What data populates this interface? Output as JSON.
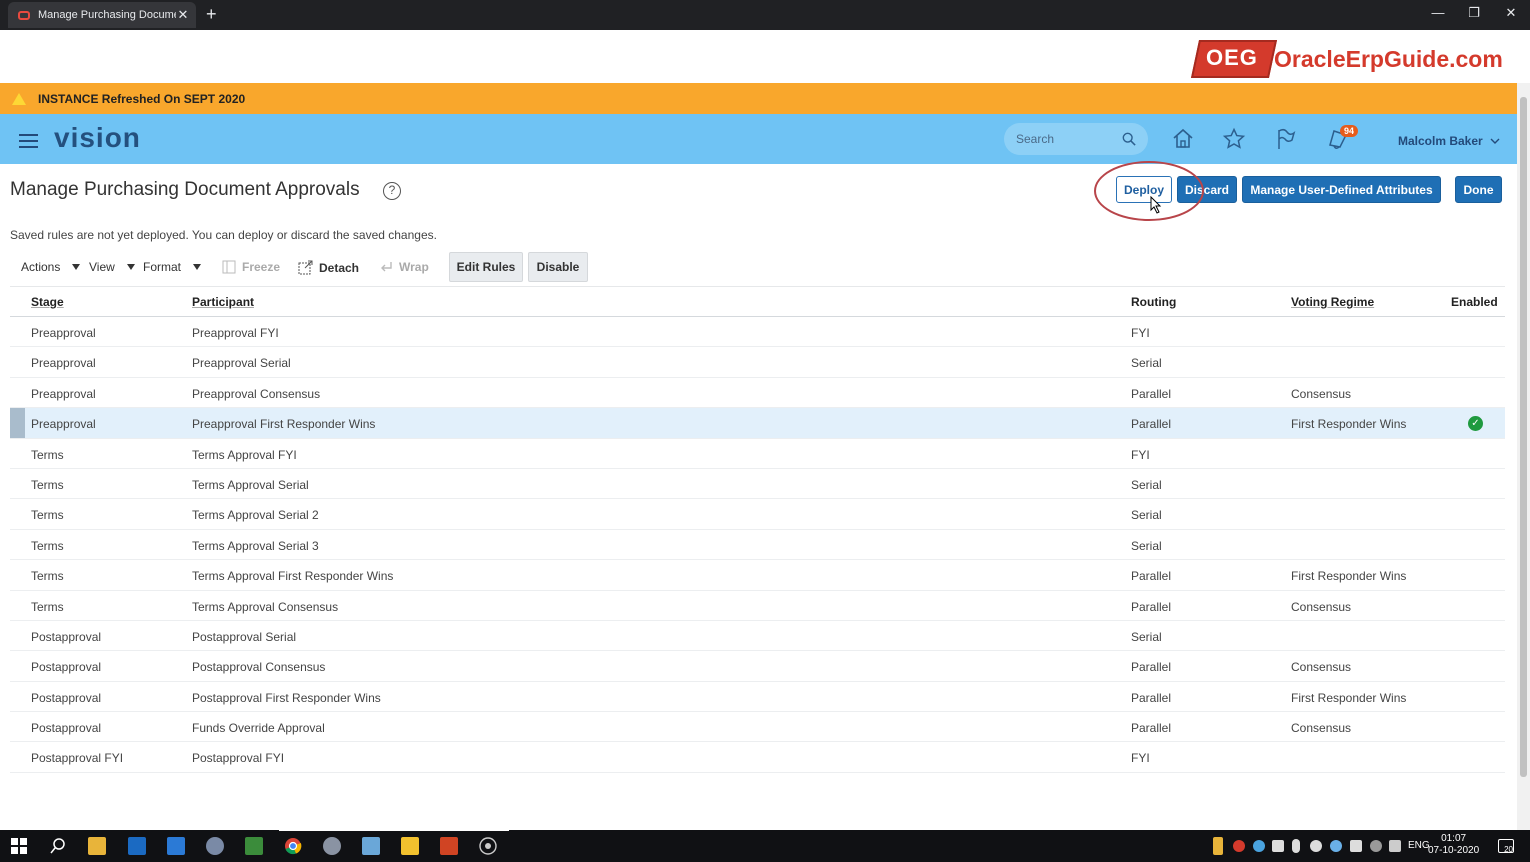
{
  "browser": {
    "tab_title": "Manage Purchasing Document A",
    "new_tab": "+",
    "tab_close": "✕",
    "minimize": "—",
    "restore": "❐",
    "close": "✕"
  },
  "brand": {
    "oeg": "OEG",
    "site": "OracleErpGuide.com"
  },
  "banner": {
    "text": "INSTANCE Refreshed On SEPT 2020",
    "color": "#f9a72c"
  },
  "header": {
    "app_name": "vision",
    "search_placeholder": "Search",
    "notifications_count": "94",
    "user_name": "Malcolm Baker",
    "accent": "#6fc3f4"
  },
  "page": {
    "title": "Manage Purchasing Document Approvals",
    "help": "?",
    "message": "Saved rules are not yet deployed. You can deploy or discard the saved changes.",
    "buttons": {
      "deploy": "Deploy",
      "discard": "Discard",
      "manage_attrs": "Manage User-Defined Attributes",
      "done": "Done"
    }
  },
  "toolbar": {
    "actions": "Actions",
    "view": "View",
    "format": "Format",
    "freeze": "Freeze",
    "detach": "Detach",
    "wrap": "Wrap",
    "edit_rules": "Edit Rules",
    "disable": "Disable"
  },
  "table": {
    "headers": {
      "stage": "Stage",
      "participant": "Participant",
      "routing": "Routing",
      "voting_regime": "Voting Regime",
      "enabled": "Enabled"
    },
    "rows": [
      {
        "stage": "Preapproval",
        "participant": "Preapproval FYI",
        "routing": "FYI",
        "voting": "",
        "enabled": false,
        "selected": false
      },
      {
        "stage": "Preapproval",
        "participant": "Preapproval Serial",
        "routing": "Serial",
        "voting": "",
        "enabled": false,
        "selected": false
      },
      {
        "stage": "Preapproval",
        "participant": "Preapproval Consensus",
        "routing": "Parallel",
        "voting": "Consensus",
        "enabled": false,
        "selected": false
      },
      {
        "stage": "Preapproval",
        "participant": "Preapproval First Responder Wins",
        "routing": "Parallel",
        "voting": "First Responder Wins",
        "enabled": true,
        "selected": true
      },
      {
        "stage": "Terms",
        "participant": "Terms Approval FYI",
        "routing": "FYI",
        "voting": "",
        "enabled": false,
        "selected": false
      },
      {
        "stage": "Terms",
        "participant": "Terms Approval Serial",
        "routing": "Serial",
        "voting": "",
        "enabled": false,
        "selected": false
      },
      {
        "stage": "Terms",
        "participant": "Terms Approval Serial 2",
        "routing": "Serial",
        "voting": "",
        "enabled": false,
        "selected": false
      },
      {
        "stage": "Terms",
        "participant": "Terms Approval Serial 3",
        "routing": "Serial",
        "voting": "",
        "enabled": false,
        "selected": false
      },
      {
        "stage": "Terms",
        "participant": "Terms Approval First Responder Wins",
        "routing": "Parallel",
        "voting": "First Responder Wins",
        "enabled": false,
        "selected": false
      },
      {
        "stage": "Terms",
        "participant": "Terms Approval Consensus",
        "routing": "Parallel",
        "voting": "Consensus",
        "enabled": false,
        "selected": false
      },
      {
        "stage": "Postapproval",
        "participant": "Postapproval Serial",
        "routing": "Serial",
        "voting": "",
        "enabled": false,
        "selected": false
      },
      {
        "stage": "Postapproval",
        "participant": "Postapproval Consensus",
        "routing": "Parallel",
        "voting": "Consensus",
        "enabled": false,
        "selected": false
      },
      {
        "stage": "Postapproval",
        "participant": "Postapproval First Responder Wins",
        "routing": "Parallel",
        "voting": "First Responder Wins",
        "enabled": false,
        "selected": false
      },
      {
        "stage": "Postapproval",
        "participant": "Funds Override Approval",
        "routing": "Parallel",
        "voting": "Consensus",
        "enabled": false,
        "selected": false
      },
      {
        "stage": "Postapproval FYI",
        "participant": "Postapproval FYI",
        "routing": "FYI",
        "voting": "",
        "enabled": false,
        "selected": false
      }
    ]
  },
  "taskbar": {
    "language": "ENG",
    "time": "01:07",
    "date": "07-10-2020",
    "notification_count": "20"
  }
}
